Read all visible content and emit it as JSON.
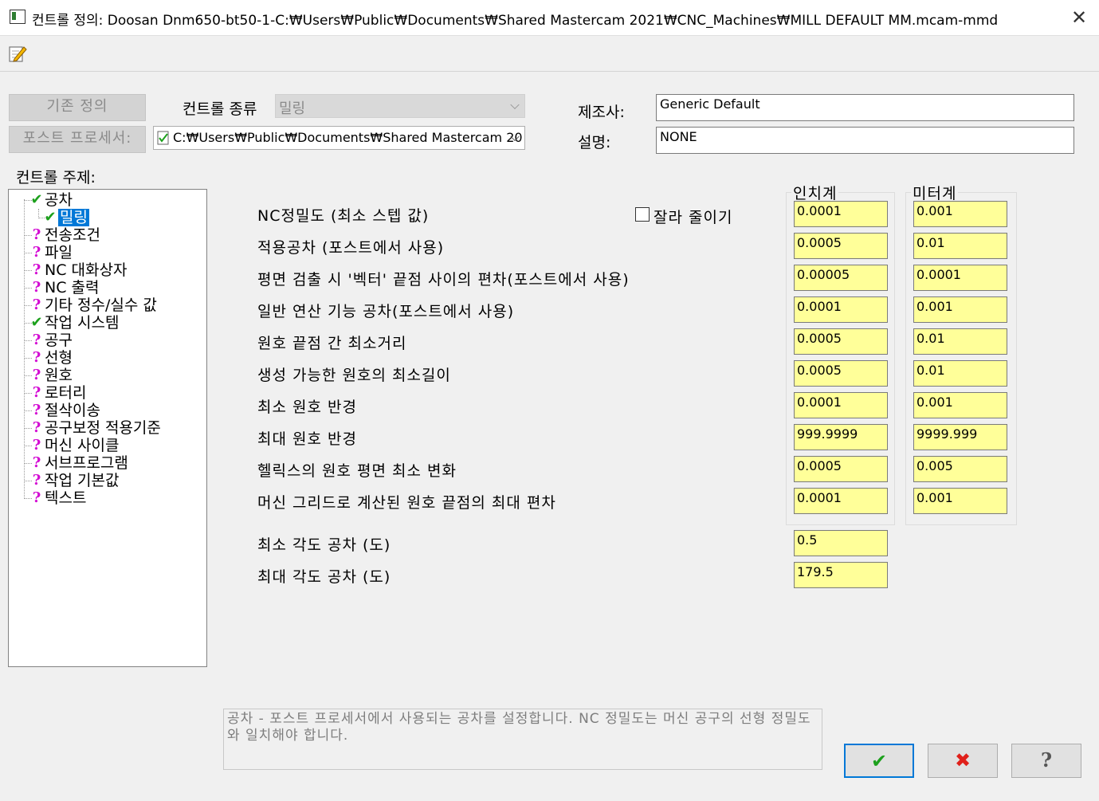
{
  "window": {
    "title": "컨트롤 정의: Doosan Dnm650-bt50-1-C:₩Users₩Public₩Documents₩Shared Mastercam 2021₩CNC_Machines₩MILL DEFAULT MM.mcam-mmd",
    "close_glyph": "✕"
  },
  "top": {
    "existing_def_label": "기존 정의",
    "post_processor_label": "포스트 프로세서:",
    "control_type_label": "컨트롤 종류",
    "control_type_value": "밀링",
    "post_path_value": "C:₩Users₩Public₩Documents₩Shared Mastercam 20",
    "manufacturer_label": "제조사:",
    "manufacturer_value": "Generic Default",
    "description_label": "설명:",
    "description_value": "NONE"
  },
  "tree": {
    "title": "컨트롤 주제:",
    "items": [
      {
        "label": "공차",
        "status": "ok"
      },
      {
        "label": "밀링",
        "status": "ok"
      },
      {
        "label": "전송조건",
        "status": "q"
      },
      {
        "label": "파일",
        "status": "q"
      },
      {
        "label": "NC 대화상자",
        "status": "q"
      },
      {
        "label": "NC 출력",
        "status": "q"
      },
      {
        "label": "기타 정수/실수 값",
        "status": "q"
      },
      {
        "label": "작업 시스템",
        "status": "ok"
      },
      {
        "label": "공구",
        "status": "q"
      },
      {
        "label": "선형",
        "status": "q"
      },
      {
        "label": "원호",
        "status": "q"
      },
      {
        "label": "로터리",
        "status": "q"
      },
      {
        "label": "절삭이송",
        "status": "q"
      },
      {
        "label": "공구보정 적용기준",
        "status": "q"
      },
      {
        "label": "머신 사이클",
        "status": "q"
      },
      {
        "label": "서브프로그램",
        "status": "q"
      },
      {
        "label": "작업 기본값",
        "status": "q"
      },
      {
        "label": "텍스트",
        "status": "q"
      }
    ],
    "glyph_ok": "✔",
    "glyph_q": "?"
  },
  "tolerances": {
    "inch_header": "인치계",
    "metric_header": "미터계",
    "truncate_label": "잘라 줄이기",
    "rows": [
      {
        "label": "NC정밀도 (최소 스텝 값)",
        "inch": "0.0001",
        "metric": "0.001"
      },
      {
        "label": "적용공차 (포스트에서 사용)",
        "inch": "0.0005",
        "metric": "0.01"
      },
      {
        "label": "평면 검출 시 '벡터' 끝점 사이의 편차(포스트에서 사용)",
        "inch": "0.00005",
        "metric": "0.0001"
      },
      {
        "label": "일반 연산 기능 공차(포스트에서 사용)",
        "inch": "0.0001",
        "metric": "0.001"
      },
      {
        "label": "원호 끝점 간 최소거리",
        "inch": "0.0005",
        "metric": "0.01"
      },
      {
        "label": "생성 가능한 원호의 최소길이",
        "inch": "0.0005",
        "metric": "0.01"
      },
      {
        "label": "최소 원호 반경",
        "inch": "0.0001",
        "metric": "0.001"
      },
      {
        "label": "최대 원호 반경",
        "inch": "999.9999",
        "metric": "9999.999"
      },
      {
        "label": "헬릭스의 원호 평면 최소 변화",
        "inch": "0.0005",
        "metric": "0.005"
      },
      {
        "label": "머신 그리드로 계산된 원호 끝점의 최대 편차",
        "inch": "0.0001",
        "metric": "0.001"
      }
    ],
    "angle_rows": [
      {
        "label": "최소 각도 공차 (도)",
        "value": "0.5"
      },
      {
        "label": "최대 각도 공차 (도)",
        "value": "179.5"
      }
    ]
  },
  "help_text": "공차 - 포스트 프로세서에서 사용되는 공차를 설정합니다. NC 정밀도는 머신 공구의 선형 정밀도와 일치해야 합니다.",
  "buttons": {
    "ok_glyph": "✔",
    "cancel_glyph": "✖",
    "help_glyph": "?"
  },
  "colors": {
    "ok": "#1ca01c",
    "cancel": "#e0201a",
    "question": "#d30bd3",
    "field_bg": "#ffff99",
    "selection": "#0078d7"
  }
}
